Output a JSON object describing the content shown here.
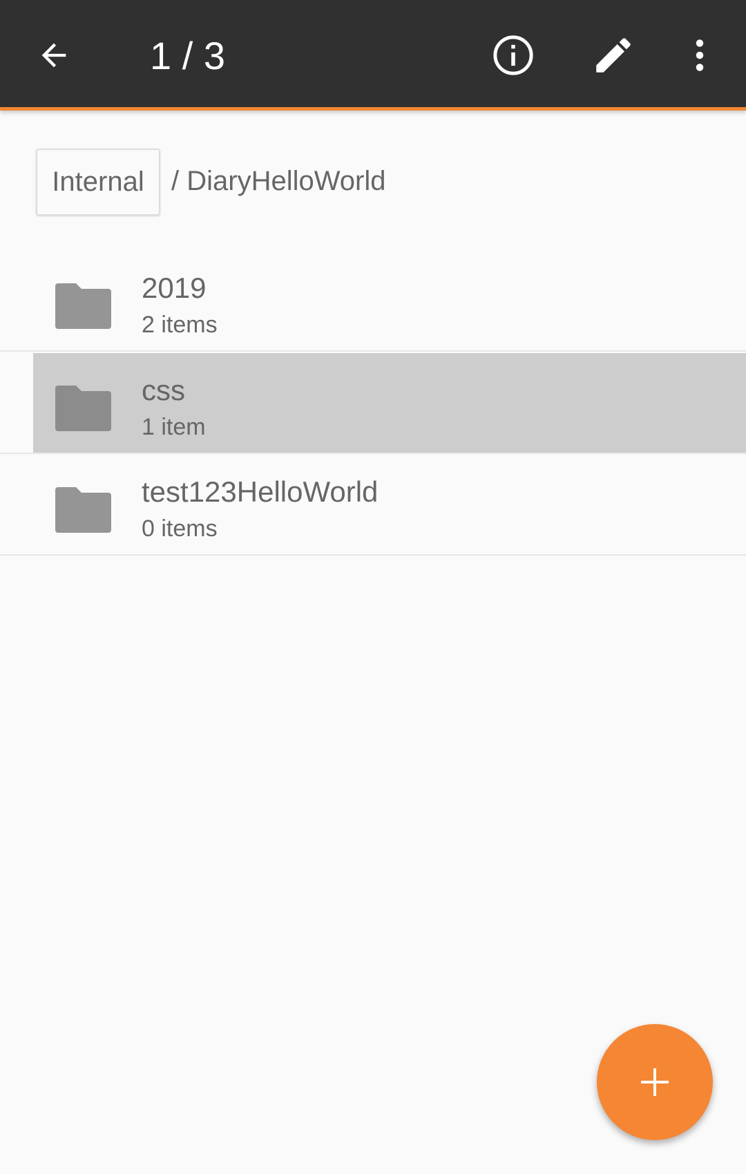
{
  "toolbar": {
    "title": "1 / 3",
    "icons": [
      "arrow-back-icon",
      "info-icon",
      "edit-pencil-icon",
      "more-vert-icon"
    ],
    "accent": "#f58634",
    "background": "#303030"
  },
  "breadcrumb": {
    "root": "Internal",
    "path": "/ DiaryHelloWorld"
  },
  "folders": [
    {
      "name": "2019",
      "count": "2 items",
      "selected": false
    },
    {
      "name": "css",
      "count": "1 item",
      "selected": true
    },
    {
      "name": "test123HelloWorld",
      "count": "0 items",
      "selected": false
    }
  ],
  "fab": {
    "icon": "plus-icon",
    "color": "#f58634"
  }
}
